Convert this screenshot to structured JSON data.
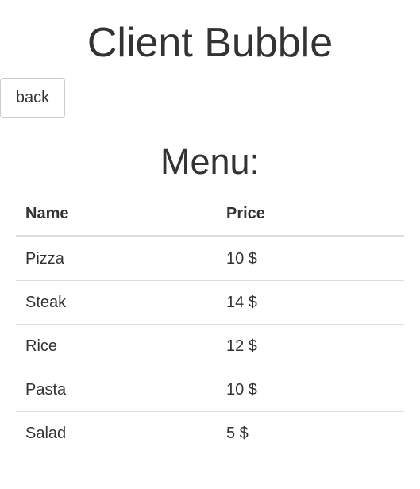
{
  "header": {
    "title": "Client Bubble"
  },
  "nav": {
    "back_label": "back"
  },
  "menu": {
    "heading": "Menu:",
    "columns": [
      "Name",
      "Price"
    ],
    "rows": [
      {
        "name": "Pizza",
        "price": "10 $"
      },
      {
        "name": "Steak",
        "price": "14 $"
      },
      {
        "name": "Rice",
        "price": "12 $"
      },
      {
        "name": "Pasta",
        "price": "10 $"
      },
      {
        "name": "Salad",
        "price": "5 $"
      }
    ]
  }
}
